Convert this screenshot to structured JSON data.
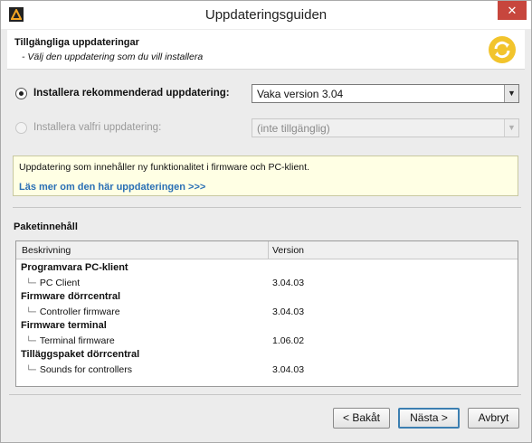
{
  "window": {
    "title": "Uppdateringsguiden",
    "close_label": "✕"
  },
  "header": {
    "title": "Tillgängliga uppdateringar",
    "subtitle": "- Välj den uppdatering som du vill installera"
  },
  "options": {
    "recommended": {
      "label": "Installera rekommenderad uppdatering:",
      "selected": true,
      "value": "Vaka version 3.04"
    },
    "optional": {
      "label": "Installera valfri uppdatering:",
      "selected": false,
      "value": "(inte tillgänglig)"
    }
  },
  "info": {
    "text": "Uppdatering som innehåller ny funktionalitet i firmware och PC-klient.",
    "link": "Läs mer om den här uppdateringen >>>"
  },
  "package": {
    "label": "Paketinnehåll",
    "columns": [
      "Beskrivning",
      "Version"
    ],
    "rows": [
      {
        "type": "group",
        "name": "Programvara PC-klient",
        "version": ""
      },
      {
        "type": "child",
        "name": "PC Client",
        "version": "3.04.03"
      },
      {
        "type": "group",
        "name": "Firmware dörrcentral",
        "version": ""
      },
      {
        "type": "child",
        "name": "Controller firmware",
        "version": "3.04.03"
      },
      {
        "type": "group",
        "name": "Firmware terminal",
        "version": ""
      },
      {
        "type": "child",
        "name": "Terminal firmware",
        "version": "1.06.02"
      },
      {
        "type": "group",
        "name": "Tilläggspaket dörrcentral",
        "version": ""
      },
      {
        "type": "child",
        "name": "Sounds for controllers",
        "version": "3.04.03"
      }
    ]
  },
  "buttons": {
    "back": "< Bakåt",
    "next": "Nästa >",
    "cancel": "Avbryt"
  },
  "colors": {
    "accent_icon": "#f2c42c",
    "link": "#2a6fb5",
    "info_bg": "#ffffe4",
    "close_bg": "#c7463d"
  }
}
